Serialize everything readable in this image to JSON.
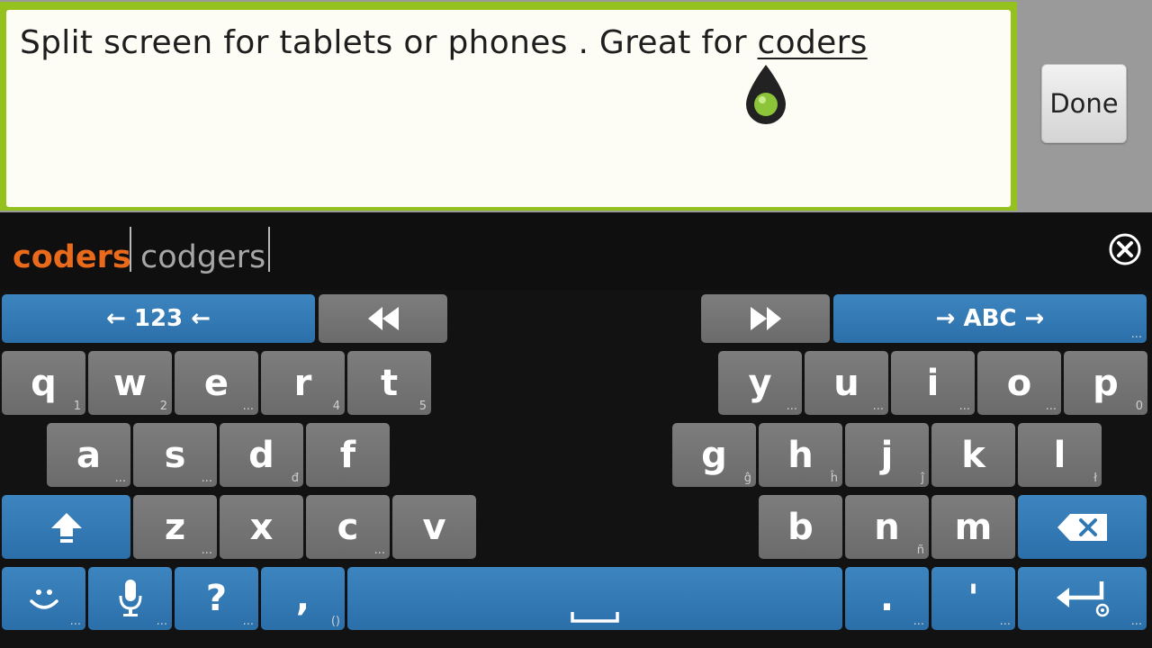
{
  "editor": {
    "text_before": "Split screen for tablets or phones . Great for ",
    "current_word": "coders"
  },
  "done_label": "Done",
  "suggestions": [
    "coders",
    "codgers"
  ],
  "keyboard": {
    "row0": {
      "left_mode": "← 123 ←",
      "right_mode": "→ ABC →",
      "hint": "..."
    },
    "left_rows": [
      [
        [
          "q",
          "1"
        ],
        [
          "w",
          "2"
        ],
        [
          "e",
          "..."
        ],
        [
          "r",
          "4"
        ],
        [
          "t",
          "5"
        ]
      ],
      [
        [
          "a",
          "..."
        ],
        [
          "s",
          "..."
        ],
        [
          "d",
          "đ"
        ],
        [
          "f",
          ""
        ]
      ],
      [
        [
          "z",
          "..."
        ],
        [
          "x",
          ""
        ],
        [
          "c",
          "..."
        ],
        [
          "v",
          ""
        ]
      ]
    ],
    "right_rows": [
      [
        [
          "y",
          "..."
        ],
        [
          "u",
          "..."
        ],
        [
          "i",
          "..."
        ],
        [
          "o",
          "..."
        ],
        [
          "p",
          "0"
        ]
      ],
      [
        [
          "g",
          "ĝ"
        ],
        [
          "h",
          "ĥ"
        ],
        [
          "j",
          "ĵ"
        ],
        [
          "k",
          ""
        ],
        [
          "l",
          "ł"
        ]
      ],
      [
        [
          "b",
          ""
        ],
        [
          "n",
          "ñ"
        ],
        [
          "m",
          ""
        ]
      ]
    ],
    "bottom": {
      "question": "?",
      "question_hint": "...",
      "comma": ",",
      "comma_hint": "()",
      "period": ".",
      "period_hint": "...",
      "apostrophe": "'",
      "apostrophe_hint": "...",
      "smiley_hint": "...",
      "mic_hint": "...",
      "enter_hint": "..."
    }
  },
  "colors": {
    "editor_border": "#95c11f",
    "suggestion_primary": "#ea6a1b",
    "key_gray": "#737373",
    "key_blue": "#2f78b4"
  }
}
